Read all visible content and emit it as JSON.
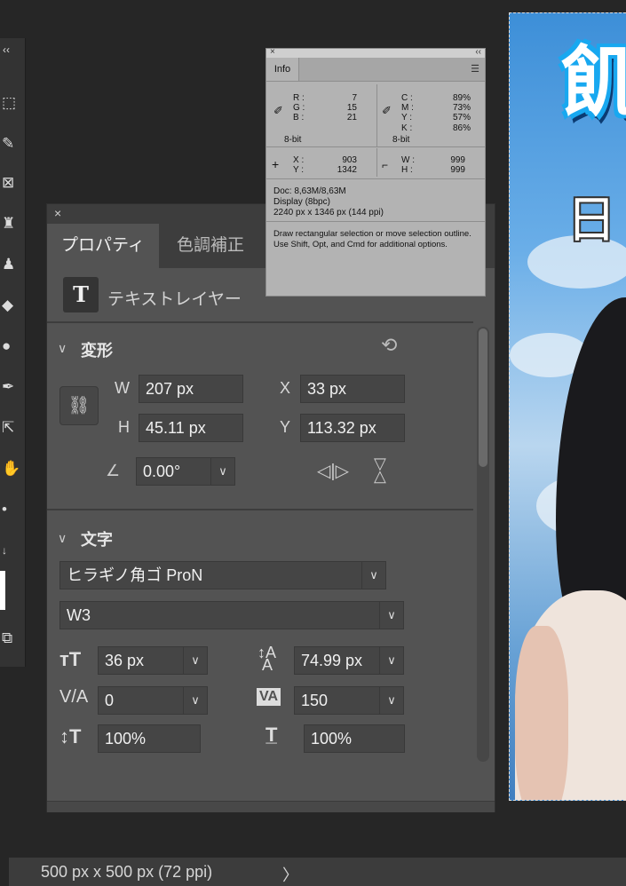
{
  "tools_panel": {
    "collapse": "‹‹"
  },
  "properties": {
    "close": "×",
    "tabs": [
      {
        "label": "プロパティ"
      },
      {
        "label": "色調補正"
      }
    ],
    "layer_type_icon": "T",
    "layer_type_label": "テキストレイヤー",
    "transform": {
      "title": "変形",
      "w_label": "W",
      "w_value": "207 px",
      "x_label": "X",
      "x_value": "33 px",
      "h_label": "H",
      "h_value": "45.11 px",
      "y_label": "Y",
      "y_value": "113.32 px",
      "angle_value": "0.00°"
    },
    "character": {
      "title": "文字",
      "font_family": "ヒラギノ角ゴ ProN",
      "font_style": "W3",
      "font_size": "36 px",
      "leading": "74.99 px",
      "kerning": "0",
      "tracking": "150",
      "vertical_scale": "100%",
      "horizontal_scale": "100%"
    }
  },
  "info": {
    "tab": "Info",
    "rgb": {
      "r_label": "R :",
      "r": "7",
      "g_label": "G :",
      "g": "15",
      "b_label": "B :",
      "b": "21",
      "bit": "8-bit"
    },
    "cmyk": {
      "c_label": "C :",
      "c": "89%",
      "m_label": "M :",
      "m": "73%",
      "y_label": "Y :",
      "y": "57%",
      "k_label": "K :",
      "k": "86%",
      "bit": "8-bit"
    },
    "pos": {
      "x_label": "X :",
      "x": "903",
      "y_label": "Y :",
      "y": "1342"
    },
    "size": {
      "w_label": "W :",
      "w": "999",
      "h_label": "H :",
      "h": "999"
    },
    "doc": "Doc: 8,63M/8,63M",
    "display": "Display (8bpc)",
    "dims": "2240 px x 1346 px (144 ppi)",
    "hint1": "Draw rectangular selection or move selection outline.",
    "hint2": "Use Shift, Opt, and Cmd for additional options."
  },
  "canvas": {
    "glyph1": "飢",
    "glyph2": "日"
  },
  "status": {
    "text": "500 px x 500 px (72 ppi)",
    "arrow": "〉"
  }
}
